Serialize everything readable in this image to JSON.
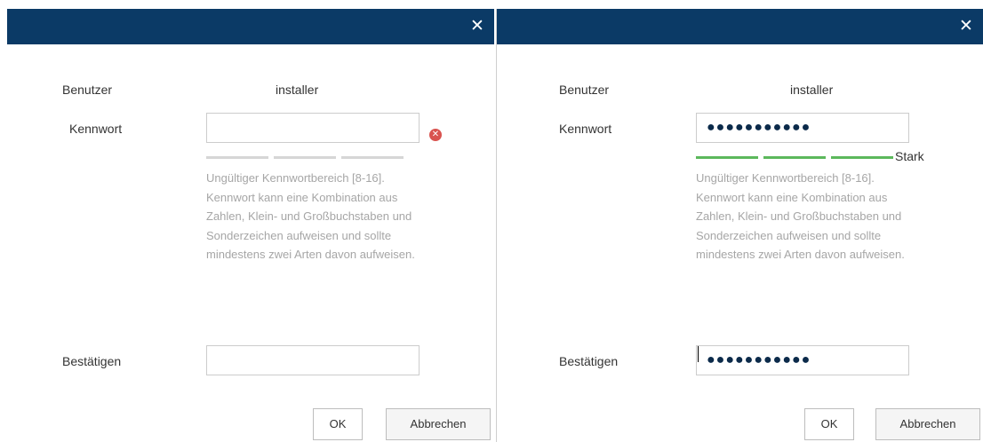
{
  "dialogs": [
    {
      "close_glyph": "✕",
      "user_label": "Benutzer",
      "user_value": "installer",
      "password_label": "Kennwort",
      "password_value": "",
      "error_icon": "x-circle-icon",
      "strength_label": "",
      "hint": "Ungültiger Kennwortbereich [8-16]. Kennwort kann eine Kombination aus Zahlen, Klein- und Großbuchstaben und Sonderzeichen aufweisen und sollte mindestens zwei Arten davon aufweisen.",
      "confirm_label": "Bestätigen",
      "confirm_value": "",
      "ok_label": "OK",
      "cancel_label": "Abbrechen"
    },
    {
      "close_glyph": "✕",
      "user_label": "Benutzer",
      "user_value": "installer",
      "password_label": "Kennwort",
      "password_value": "●●●●●●●●●●●",
      "strength_label": "Stark",
      "hint": "Ungültiger Kennwortbereich [8-16]. Kennwort kann eine Kombination aus Zahlen, Klein- und Großbuchstaben und Sonderzeichen aufweisen und sollte mindestens zwei Arten davon aufweisen.",
      "confirm_label": "Bestätigen",
      "confirm_value": "●●●●●●●●●●●",
      "ok_label": "OK",
      "cancel_label": "Abbrechen"
    }
  ],
  "colors": {
    "titlebar": "#0b3a66",
    "strength_weak_segment": "#d6d6d6",
    "strength_strong_segment": "#5cb85c",
    "error": "#d9534f",
    "hint_text": "#a6a6a6"
  }
}
